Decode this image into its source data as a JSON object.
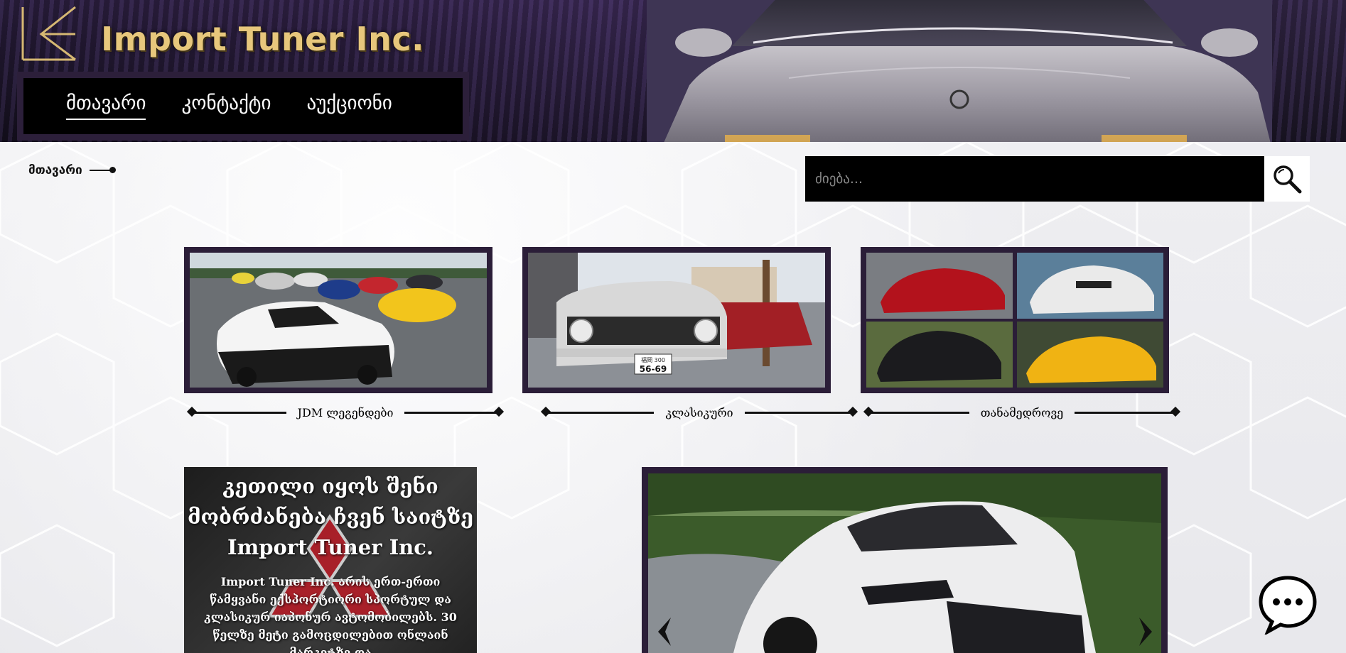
{
  "header": {
    "brand": "Import Tuner Inc.",
    "nav": [
      {
        "label": "მთავარი",
        "active": true
      },
      {
        "label": "კონტაქტი",
        "active": false
      },
      {
        "label": "აუქციონი",
        "active": false
      }
    ]
  },
  "breadcrumb": {
    "label": "მთავარი"
  },
  "search": {
    "placeholder": "ძიება..."
  },
  "categories": [
    {
      "label": "JDM ლეგენდები"
    },
    {
      "label": "კლასიკური"
    },
    {
      "label": "თანამედროვე"
    }
  ],
  "welcome": {
    "title_line1": "კეთილი იყოს შენი",
    "title_line2": "მობრძანება ჩვენ საიტზე",
    "title_line3": "Import Tuner Inc.",
    "body": "Import Tuner Inc. არის ერთ-ერთი წამყვანი ექსპორტიორი სპორტულ და კლასიკურ იაპონურ ავტომობილებს. 30 წელზე მეტი გამოცდილებით ონლაინ მარკეტზე და"
  },
  "plate": {
    "line1": "福岡 300",
    "line2": "56-69"
  },
  "icons": {
    "logo": "stylized-k-logo-icon",
    "search": "magnifier-icon",
    "chat": "chat-bubble-icon",
    "prev": "chevron-left-icon",
    "next": "chevron-right-icon"
  },
  "colors": {
    "brand_gold": "#e7c77c",
    "frame_purple": "#2b1e38",
    "nav_bg": "#000000"
  }
}
